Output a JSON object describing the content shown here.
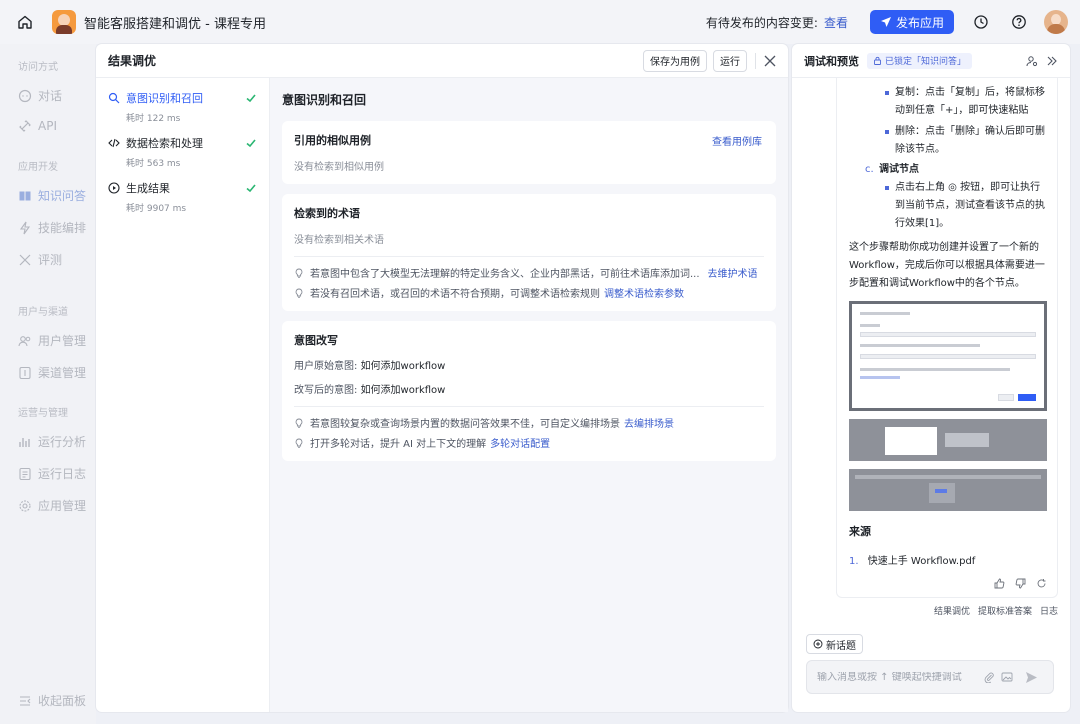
{
  "topbar": {
    "title": "智能客服搭建和调优 - 课程专用",
    "pending_text": "有待发布的内容变更:",
    "pending_link": "查看",
    "publish_label": "发布应用"
  },
  "sidebar": {
    "sections": [
      "访问方式",
      "应用开发",
      "用户与渠道",
      "运营与管理"
    ],
    "items": [
      "对话",
      "API",
      "知识问答",
      "技能编排",
      "评测",
      "用户管理",
      "渠道管理",
      "运行分析",
      "运行日志",
      "应用管理"
    ],
    "collapse_label": "收起面板"
  },
  "main": {
    "title": "结果调优",
    "save_case_label": "保存为用例",
    "run_label": "运行",
    "steps": [
      {
        "label": "意图识别和召回",
        "time": "耗时 122 ms"
      },
      {
        "label": "数据检索和处理",
        "time": "耗时 563 ms"
      },
      {
        "label": "生成结果",
        "time": "耗时 9907 ms"
      }
    ],
    "content_title": "意图识别和召回",
    "card1": {
      "title": "引用的相似用例",
      "link": "查看用例库",
      "empty": "没有检索到相似用例"
    },
    "card2": {
      "title": "检索到的术语",
      "empty": "没有检索到相关术语",
      "tip1": "若意图中包含了大模型无法理解的特定业务含义、企业内部黑话，可前往术语库添加词...",
      "tip1_link": "去维护术语",
      "tip2": "若没有召回术语，或召回的术语不符合预期，可调整术语检索规则",
      "tip2_link": "调整术语检索参数"
    },
    "card3": {
      "title": "意图改写",
      "orig_label": "用户原始意图:",
      "orig_value": "如何添加workflow",
      "rewrite_label": "改写后的意图:",
      "rewrite_value": "如何添加workflow",
      "tip1": "若意图较复杂或查询场景内置的数据问答效果不佳，可自定义编排场景",
      "tip1_link": "去编排场景",
      "tip2": "打开多轮对话，提升 AI 对上下文的理解",
      "tip2_link": "多轮对话配置"
    }
  },
  "right": {
    "title": "调试和预览",
    "lock_badge": "已锁定「知识问答」",
    "bullet1": "复制：点击「复制」后，将鼠标移动到任意「+」，即可快速粘贴",
    "bullet2": "删除：点击「删除」确认后即可删除该节点。",
    "sub_c_letter": "c.",
    "sub_c": "调试节点",
    "bullet3": "点击右上角 ◎ 按钮，即可让执行到当前节点，测试查看该节点的执行效果[1]。",
    "para": "这个步骤帮助你成功创建并设置了一个新的Workflow，完成后你可以根据具体需要进一步配置和调试Workflow中的各个节点。",
    "source_title": "来源",
    "source_num": "1.",
    "source_item": "快速上手 Workflow.pdf",
    "meta": [
      "结果调优",
      "提取标准答案",
      "日志"
    ],
    "new_topic": "新话题",
    "input_placeholder": "输入消息或按 ↑ 键唤起快捷调试"
  },
  "colors": {
    "accent": "#2f5df5",
    "link": "#3a5ccc",
    "success": "#2bb673"
  }
}
